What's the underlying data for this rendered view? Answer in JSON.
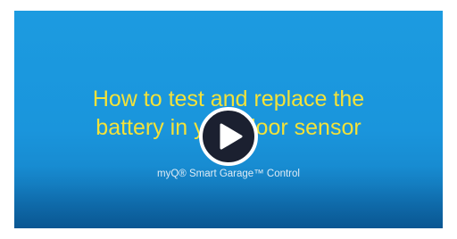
{
  "video": {
    "title_line1": "How to test and replace the",
    "title_line2": "battery in your door sensor",
    "subtitle": "myQ® Smart Garage™ Control"
  },
  "colors": {
    "background": "#1c9be0",
    "title": "#f3e23a",
    "subtitle": "#e8f4fc",
    "play_button": "#1b2030"
  },
  "icons": {
    "play": "play-icon"
  }
}
